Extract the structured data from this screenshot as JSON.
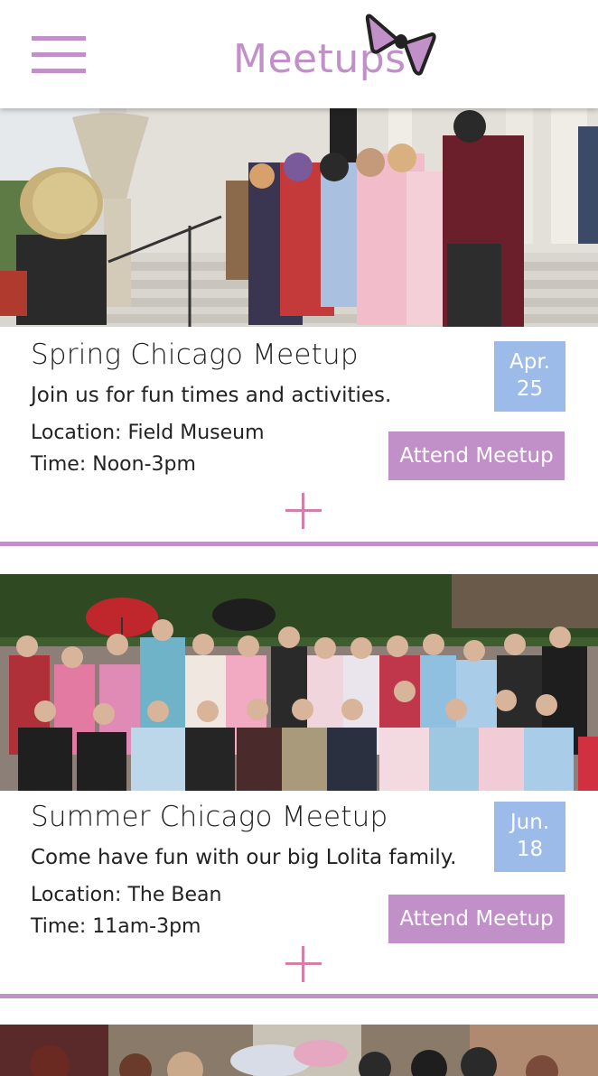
{
  "header": {
    "title": "Meetups",
    "menu_icon": "hamburger-menu-icon",
    "logo_icon": "bow-icon",
    "brand_color": "#c290c8"
  },
  "meetups": [
    {
      "title": "Spring Chicago Meetup",
      "description": "Join us for fun times and activities.",
      "location": "Location: Field Museum",
      "time": "Time: Noon-3pm",
      "date_month": "Apr.",
      "date_day": "25",
      "attend_label": "Attend Meetup",
      "expand_icon": "plus-icon"
    },
    {
      "title": "Summer Chicago Meetup",
      "description": "Come have fun with our big Lolita family.",
      "location": "Location: The Bean",
      "time": "Time: 11am-3pm",
      "date_month": "Jun.",
      "date_day": "18",
      "attend_label": "Attend Meetup",
      "expand_icon": "plus-icon"
    }
  ],
  "colors": {
    "accent": "#c290c8",
    "date_badge": "#9dbbe8",
    "plus_icon": "#d57ea8"
  }
}
